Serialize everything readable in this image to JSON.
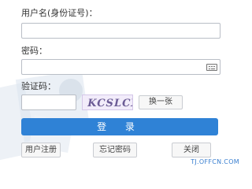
{
  "form": {
    "username_label": "用户名(身份证号)：",
    "username_value": "",
    "password_label": "密码：",
    "password_value": "",
    "captcha_label": "验证码：",
    "captcha_value": "",
    "captcha_text": "KCSLCX",
    "refresh_label": "换一张",
    "login_label": "登 录"
  },
  "actions": {
    "register_label": "用户注册",
    "forgot_label": "忘记密码",
    "close_label": "关闭"
  },
  "watermark": "TJ.OFFCN.COM",
  "colors": {
    "accent": "#2f82d6"
  },
  "icons": {
    "keyboard": "keyboard-icon"
  }
}
